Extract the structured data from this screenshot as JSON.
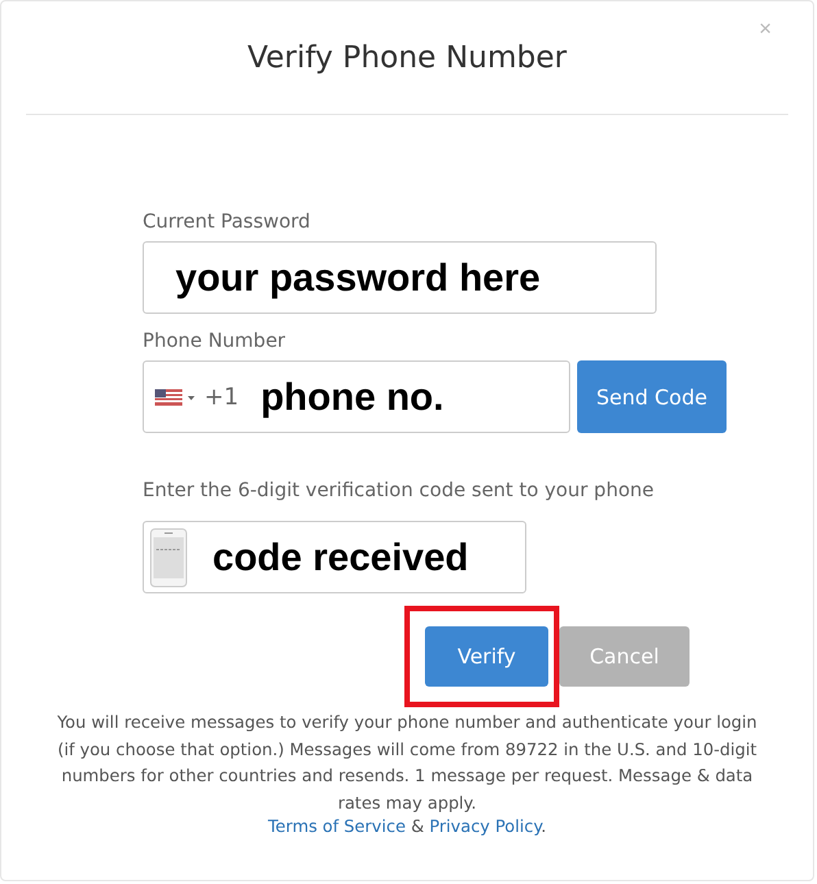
{
  "dialog": {
    "title": "Verify Phone Number",
    "close": "×"
  },
  "password": {
    "label": "Current Password",
    "value": "your password here"
  },
  "phone": {
    "label": "Phone Number",
    "country_code": "+1",
    "value": "phone no.",
    "send_button": "Send Code"
  },
  "code": {
    "label": "Enter the 6-digit verification code sent to your phone",
    "value": "code received"
  },
  "buttons": [
    {
      "label": "Verify",
      "kind": "primary",
      "highlighted": true
    },
    {
      "label": "Cancel",
      "kind": "secondary",
      "highlighted": false
    }
  ],
  "notice": {
    "text": "You will receive messages to verify your phone number and authenticate your login (if you choose that option.) Messages will come from 89722 in the U.S. and 10-digit numbers for other countries and resends. 1 message per request. Message & data rates may apply.",
    "terms_link": "Terms of Service",
    "separator": "&",
    "privacy_link": "Privacy Policy",
    "end": "."
  }
}
